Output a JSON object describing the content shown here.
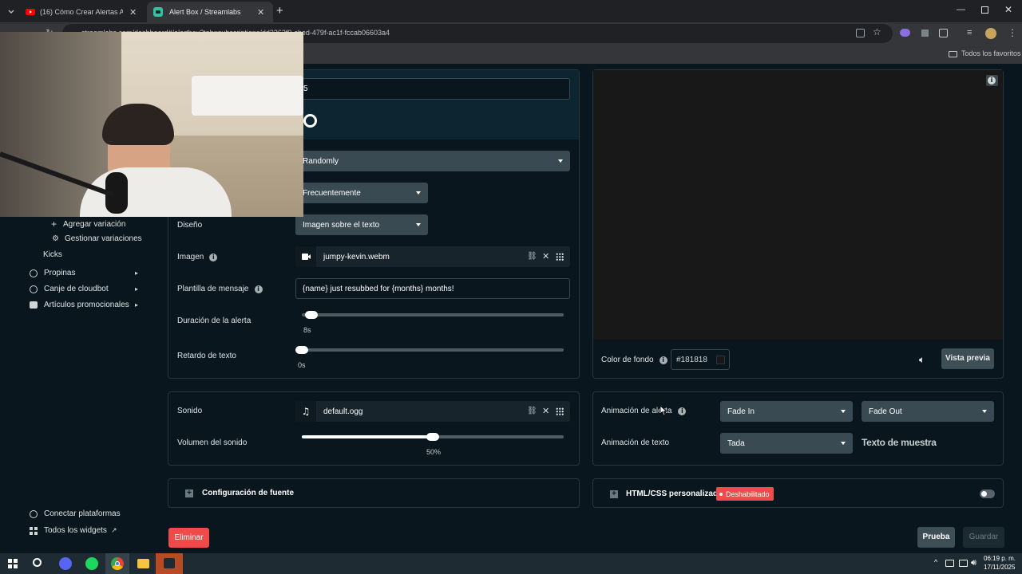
{
  "browser": {
    "tabs": [
      {
        "title": "(16) Cómo Crear Alertas Animad"
      },
      {
        "title": "Alert Box / Streamlabs"
      }
    ],
    "url": "streamlabs.com/dashboard#/alertbox?tab=subscriptions/dd3363f0-cbed-479f-ac1f-fccab06603a4",
    "bookmarks_label": "Todos los favoritos"
  },
  "sidebar": {
    "add_variation": "Agregar variación",
    "manage_variations": "Gestionar variaciones",
    "kicks": "Kicks",
    "propinas": "Propinas",
    "canje": "Canje de cloudbot",
    "articulos": "Artículos promocionales",
    "connect": "Conectar plataformas",
    "all_widgets": "Todos los widgets"
  },
  "settings": {
    "top_field_value": "5",
    "randomly": "Randomly",
    "frequency": "Frecuentemente",
    "design_label": "Diseño",
    "design_value": "Imagen sobre el texto",
    "image_label": "Imagen",
    "image_file": "jumpy-kevin.webm",
    "template_label": "Plantilla de mensaje",
    "template_value": "{name} just resubbed for {months} months!",
    "duration_label": "Duración de la alerta",
    "duration_value": "8s",
    "duration_fraction": 0.02,
    "text_delay_label": "Retardo de texto",
    "text_delay_value": "0s",
    "text_delay_fraction": 0.0
  },
  "sound": {
    "label": "Sonido",
    "file": "default.ogg",
    "volume_label": "Volumen del sonido",
    "volume_value": "50%",
    "volume_fraction": 0.5
  },
  "font_config": "Configuración de fuente",
  "preview": {
    "bg_label": "Color de fondo",
    "bg_color": "#181818",
    "preview_button": "Vista previa"
  },
  "animation": {
    "alert_anim_label": "Animación de alerta",
    "fade_in": "Fade In",
    "fade_out": "Fade Out",
    "text_anim_label": "Animación de texto",
    "text_anim_value": "Tada",
    "sample_text": "Texto de muestra"
  },
  "custom_html": {
    "label": "HTML/CSS personalizado",
    "status": "Deshabilitado"
  },
  "actions": {
    "delete": "Eliminar",
    "test": "Prueba",
    "save": "Guardar"
  },
  "taskbar": {
    "time": "06:19 p. m.",
    "date": "17/11/2025"
  },
  "colors": {
    "accent_red": "#f04a4a",
    "page_bg": "#09161d",
    "select_bg": "#3a4a52",
    "preview_bg": "#181818"
  }
}
